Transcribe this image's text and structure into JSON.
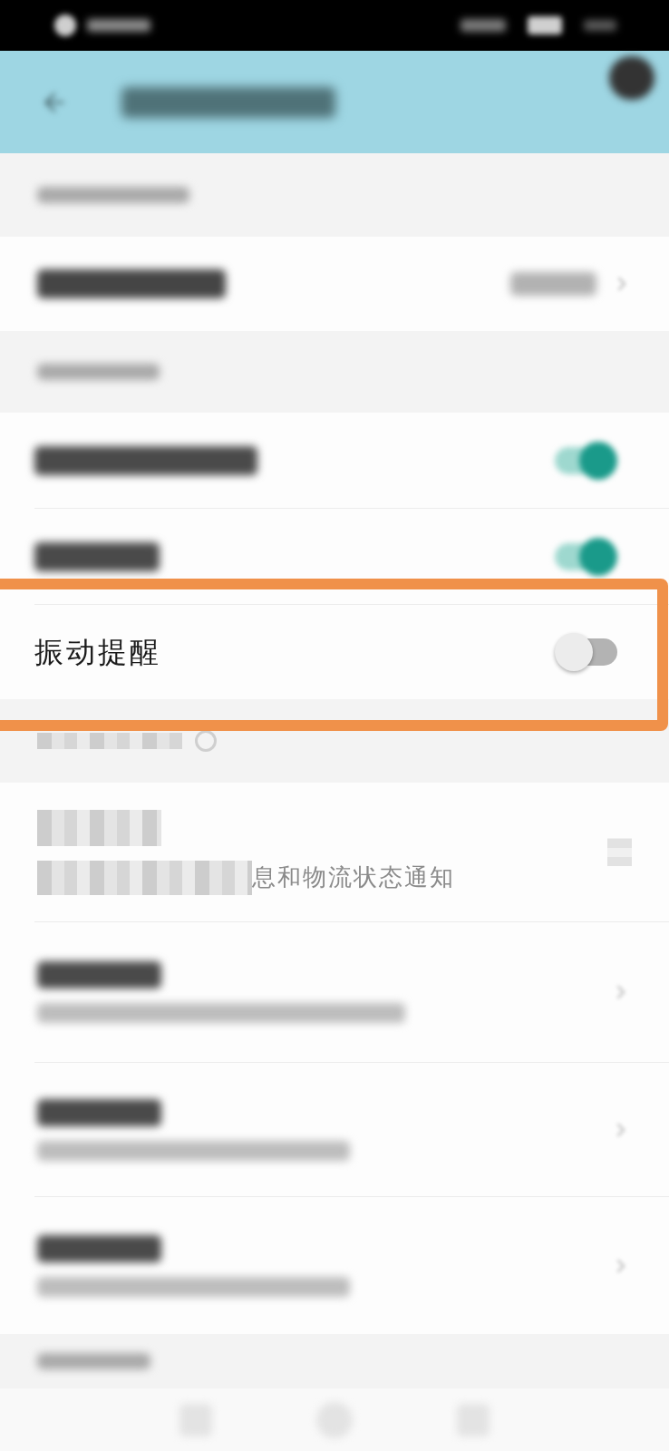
{
  "settings": [
    {
      "kind": "section_header",
      "blurred": true,
      "pixelated": false,
      "highlighted": false
    },
    {
      "kind": "value_link",
      "blurred": true,
      "pixelated": false,
      "highlighted": false
    },
    {
      "kind": "section_header",
      "blurred": true,
      "pixelated": false,
      "highlighted": false
    },
    {
      "kind": "toggle",
      "blurred": true,
      "pixelated": false,
      "on": true,
      "highlighted": false
    },
    {
      "kind": "toggle",
      "blurred": true,
      "pixelated": false,
      "on": true,
      "highlighted": false
    },
    {
      "kind": "toggle",
      "label": "振动提醒",
      "blurred": false,
      "pixelated": false,
      "on": false,
      "highlighted": true
    },
    {
      "kind": "section_header",
      "blurred": false,
      "pixelated": true,
      "highlighted": false
    },
    {
      "kind": "detail_link",
      "subtitle": "息和物流状态通知",
      "blurred": false,
      "pixelated": true,
      "highlighted": false
    },
    {
      "kind": "detail_link",
      "blurred": true,
      "pixelated": false,
      "highlighted": false
    },
    {
      "kind": "detail_link",
      "blurred": true,
      "pixelated": false,
      "highlighted": false
    },
    {
      "kind": "detail_link",
      "blurred": true,
      "pixelated": false,
      "highlighted": false
    },
    {
      "kind": "section_header",
      "blurred": true,
      "pixelated": false,
      "highlighted": false
    }
  ]
}
